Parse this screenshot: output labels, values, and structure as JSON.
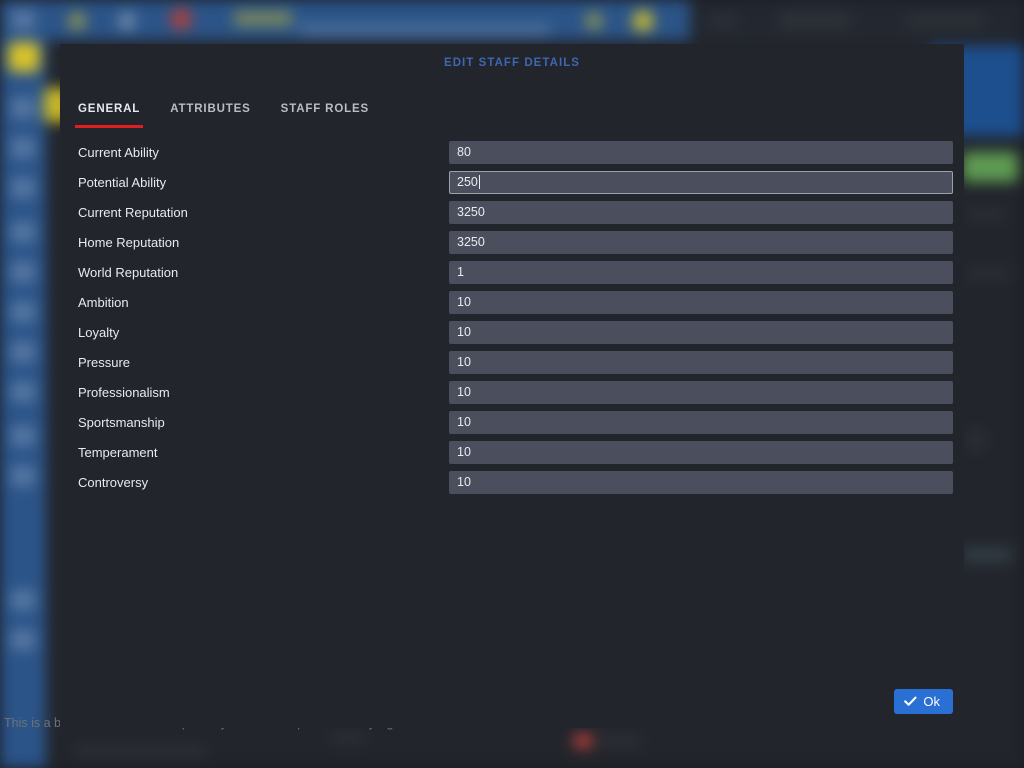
{
  "dialog": {
    "title": "EDIT STAFF DETAILS",
    "tabs": [
      {
        "label": "GENERAL",
        "active": true
      },
      {
        "label": "ATTRIBUTES",
        "active": false
      },
      {
        "label": "STAFF ROLES",
        "active": false
      }
    ],
    "fields": [
      {
        "label": "Current Ability",
        "value": "80",
        "focused": false
      },
      {
        "label": "Potential Ability",
        "value": "250",
        "focused": true
      },
      {
        "label": "Current Reputation",
        "value": "3250",
        "focused": false
      },
      {
        "label": "Home Reputation",
        "value": "3250",
        "focused": false
      },
      {
        "label": "World Reputation",
        "value": "1",
        "focused": false
      },
      {
        "label": "Ambition",
        "value": "10",
        "focused": false
      },
      {
        "label": "Loyalty",
        "value": "10",
        "focused": false
      },
      {
        "label": "Pressure",
        "value": "10",
        "focused": false
      },
      {
        "label": "Professionalism",
        "value": "10",
        "focused": false
      },
      {
        "label": "Sportsmanship",
        "value": "10",
        "focused": false
      },
      {
        "label": "Temperament",
        "value": "10",
        "focused": false
      },
      {
        "label": "Controversy",
        "value": "10",
        "focused": false
      }
    ],
    "ok_label": "Ok",
    "ok_icon": "check-icon"
  },
  "statusbar": {
    "text": "This is a beta version. Please report any issues at http://community.sigames.com/"
  },
  "colors": {
    "accent_red": "#e02020",
    "title_blue": "#3f67b0",
    "button_blue": "#2a6fd4",
    "dialog_bg": "#22252c",
    "input_bg": "#4b4f5d",
    "sidebar_blue": "#2b5489",
    "badge_green": "#5e9a52",
    "badge_yellow": "#d8c32a"
  }
}
